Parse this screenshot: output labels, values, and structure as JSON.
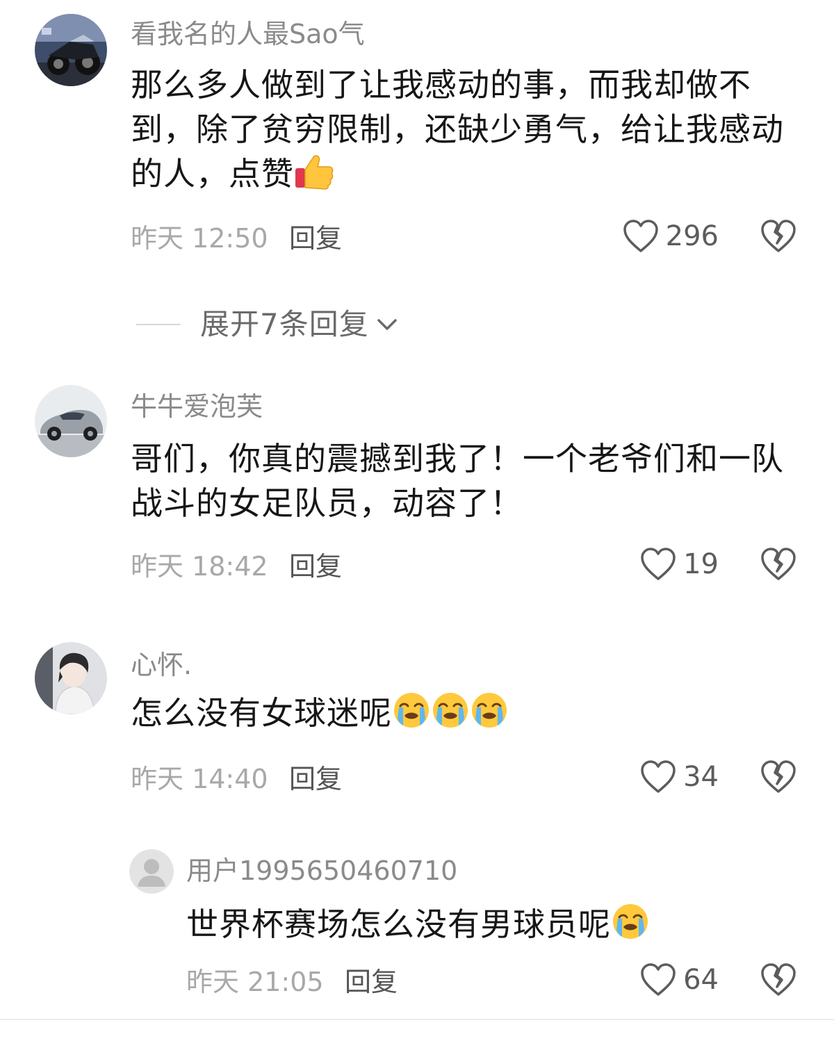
{
  "comments": [
    {
      "username": "看我名的人最Sao气",
      "text": "那么多人做到了让我感动的事，而我却做不到，除了贫穷限制，还缺少勇气，给让我感动的人，点赞",
      "emoji": "thumbs-up",
      "time": "昨天 12:50",
      "reply_label": "回复",
      "likes": "296"
    },
    {
      "username": "牛牛爱泡芙",
      "text": "哥们，你真的震撼到我了！一个老爷们和一队战斗的女足队员，动容了！",
      "time": "昨天 18:42",
      "reply_label": "回复",
      "likes": "19"
    },
    {
      "username": "心怀.",
      "text": "怎么没有女球迷呢",
      "emoji": "loudly-crying-face",
      "emoji_count": 3,
      "time": "昨天 14:40",
      "reply_label": "回复",
      "likes": "34"
    }
  ],
  "expand": {
    "label": "展开7条回复"
  },
  "reply": {
    "username": "用户1995650460710",
    "text": "世界杯赛场怎么没有男球员呢",
    "emoji": "loudly-crying-face",
    "time": "昨天 21:05",
    "reply_label": "回复",
    "likes": "64"
  },
  "icons": {
    "like": "heart-outline-icon",
    "dislike": "broken-heart-icon",
    "expand": "chevron-down-icon"
  }
}
